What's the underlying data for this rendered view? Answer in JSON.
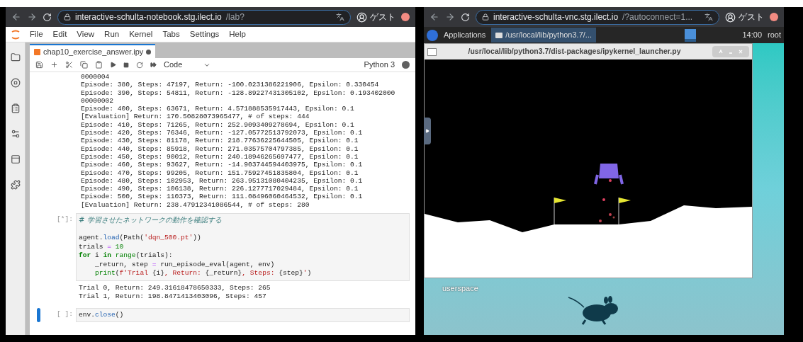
{
  "left_browser": {
    "url_host": "interactive-schulta-notebook.stg.ilect.io",
    "url_path": "/lab?",
    "profile": "ゲスト"
  },
  "jupyter": {
    "menu": [
      "File",
      "Edit",
      "View",
      "Run",
      "Kernel",
      "Tabs",
      "Settings",
      "Help"
    ],
    "tab": {
      "label": "chap10_exercise_answer.ipy",
      "modified": true
    },
    "cell_type": "Code",
    "kernel": {
      "name": "Python 3",
      "busy": true
    },
    "output_lines": [
      "0000004",
      "Episode: 380, Steps: 47197, Return: -100.0231386221906, Epsilon: 0.330454",
      "Episode: 390, Steps: 54811, Return: -128.89227431305102, Epsilon: 0.193402000",
      "00000002",
      "Episode: 400, Steps: 63671, Return: 4.571888535917443, Epsilon: 0.1",
      "[Evaluation] Return: 170.50828073965477, # of steps: 444",
      "Episode: 410, Steps: 71265, Return: 252.9093409278694, Epsilon: 0.1",
      "Episode: 420, Steps: 76346, Return: -127.05772513792073, Epsilon: 0.1",
      "Episode: 430, Steps: 81178, Return: 218.77636225644505, Epsilon: 0.1",
      "Episode: 440, Steps: 85918, Return: 271.03575704797385, Epsilon: 0.1",
      "Episode: 450, Steps: 90012, Return: 240.18946265697477, Epsilon: 0.1",
      "Episode: 460, Steps: 93627, Return: -14.903744594403975, Epsilon: 0.1",
      "Episode: 470, Steps: 99205, Return: 151.75927451835804, Epsilon: 0.1",
      "Episode: 480, Steps: 102953, Return: 263.95131080404235, Epsilon: 0.1",
      "Episode: 490, Steps: 106138, Return: 226.1277717029484, Epsilon: 0.1",
      "Episode: 500, Steps: 110373, Return: 111.08496060464532, Epsilon: 0.1",
      "[Evaluation] Return: 238.47912341086544, # of steps: 280"
    ],
    "cells": [
      {
        "prompt": "[*]:",
        "selected": false,
        "code": [
          {
            "gap_before": false,
            "tokens": [
              {
                "kind": "comment",
                "text": "# 学習させたネットワークの動作を確認する"
              }
            ]
          },
          {
            "gap_before": true,
            "tokens": [
              {
                "kind": "plain",
                "text": "agent."
              },
              {
                "kind": "builtin",
                "text": "load"
              },
              {
                "kind": "plain",
                "text": "(Path("
              },
              {
                "kind": "string",
                "text": "'dqn_500.pt'"
              },
              {
                "kind": "plain",
                "text": "))"
              }
            ]
          },
          {
            "gap_before": false,
            "tokens": [
              {
                "kind": "plain",
                "text": "trials "
              },
              {
                "kind": "op",
                "text": "="
              },
              {
                "kind": "number",
                "text": " 10"
              }
            ]
          },
          {
            "gap_before": false,
            "tokens": [
              {
                "kind": "keyword",
                "text": "for"
              },
              {
                "kind": "plain",
                "text": " i "
              },
              {
                "kind": "keyword",
                "text": "in"
              },
              {
                "kind": "green",
                "text": " range"
              },
              {
                "kind": "plain",
                "text": "(trials):"
              }
            ]
          },
          {
            "gap_before": false,
            "tokens": [
              {
                "kind": "plain",
                "text": "    _return, step "
              },
              {
                "kind": "op",
                "text": "="
              },
              {
                "kind": "plain",
                "text": " run_episode_eval(agent, env)"
              }
            ]
          },
          {
            "gap_before": false,
            "tokens": [
              {
                "kind": "green",
                "text": "    print"
              },
              {
                "kind": "plain",
                "text": "("
              },
              {
                "kind": "string",
                "text": "f'Trial "
              },
              {
                "kind": "plain",
                "text": "{i}"
              },
              {
                "kind": "string",
                "text": ", Return: "
              },
              {
                "kind": "plain",
                "text": "{_return}"
              },
              {
                "kind": "string",
                "text": ", Steps: "
              },
              {
                "kind": "plain",
                "text": "{step}"
              },
              {
                "kind": "string",
                "text": "'"
              },
              {
                "kind": "plain",
                "text": ")"
              }
            ]
          }
        ],
        "output": [
          "Trial 0, Return: 249.31618478650333, Steps: 265",
          "Trial 1, Return: 198.8471413403096, Steps: 457"
        ]
      },
      {
        "prompt": "[ ]:",
        "selected": true,
        "code": [
          {
            "gap_before": false,
            "tokens": [
              {
                "kind": "plain",
                "text": "env."
              },
              {
                "kind": "builtin",
                "text": "close"
              },
              {
                "kind": "plain",
                "text": "()"
              }
            ]
          }
        ]
      }
    ]
  },
  "right_browser": {
    "url_host": "interactive-schulta-vnc.stg.ilect.io",
    "url_path": "/?autoconnect=1...",
    "profile": "ゲスト"
  },
  "desktop": {
    "panel": {
      "applications": "Applications",
      "task": "/usr/local/lib/python3.7/...",
      "clock": "14:00",
      "user": "root"
    },
    "window_title": "/usr/local/lib/python3.7/dist-packages/ipykernel_launcher.py",
    "workspace_label": "userspace"
  }
}
